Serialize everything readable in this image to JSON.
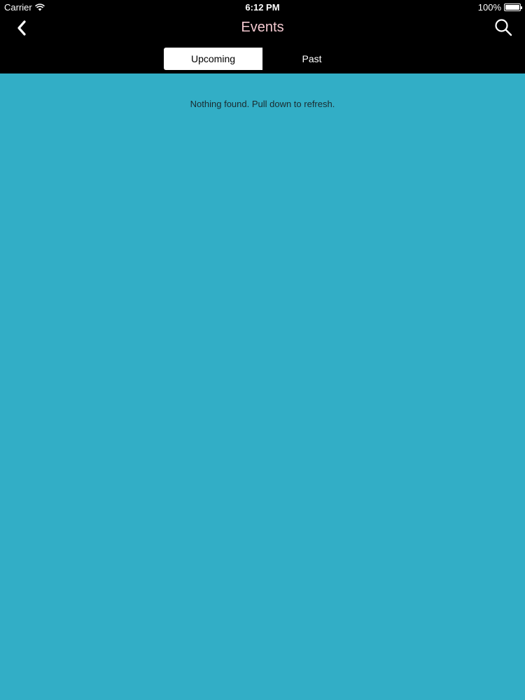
{
  "status_bar": {
    "carrier": "Carrier",
    "time": "6:12 PM",
    "battery": "100%"
  },
  "nav": {
    "title": "Events",
    "back_icon": "chevron-left-icon",
    "search_icon": "search-icon",
    "title_color": "#f4c9d0"
  },
  "tabs": [
    {
      "label": "Upcoming",
      "selected": true
    },
    {
      "label": "Past",
      "selected": false
    }
  ],
  "content": {
    "empty_text": "Nothing found. Pull down to refresh.",
    "background_color": "#32aec6"
  }
}
